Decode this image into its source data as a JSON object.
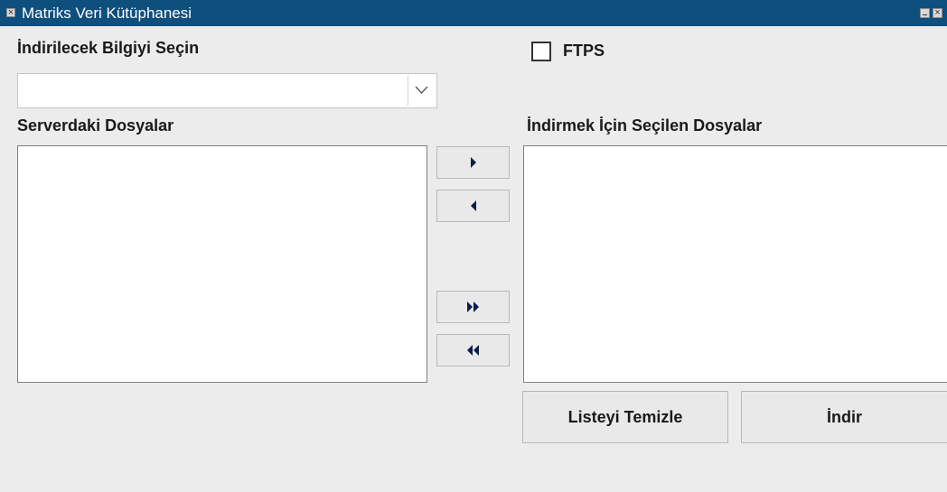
{
  "window": {
    "title": "Matriks Veri Kütüphanesi"
  },
  "form": {
    "select_label": "İndirilecek Bilgiyi Seçin",
    "select_value": "",
    "ftps_label": "FTPS",
    "ftps_checked": false,
    "server_files_label": "Serverdaki Dosyalar",
    "selected_files_label": "İndirmek İçin Seçilen Dosyalar",
    "server_files": [],
    "selected_files": []
  },
  "buttons": {
    "clear_list": "Listeyi Temizle",
    "download": "İndir"
  },
  "icons": {
    "move_right": "triangle-right-icon",
    "move_left": "triangle-left-icon",
    "move_all_right": "double-triangle-right-icon",
    "move_all_left": "double-triangle-left-icon",
    "dropdown": "chevron-down-icon"
  },
  "colors": {
    "titlebar": "#0f4f7d",
    "background": "#ececec",
    "arrow": "#0b1d4a"
  }
}
